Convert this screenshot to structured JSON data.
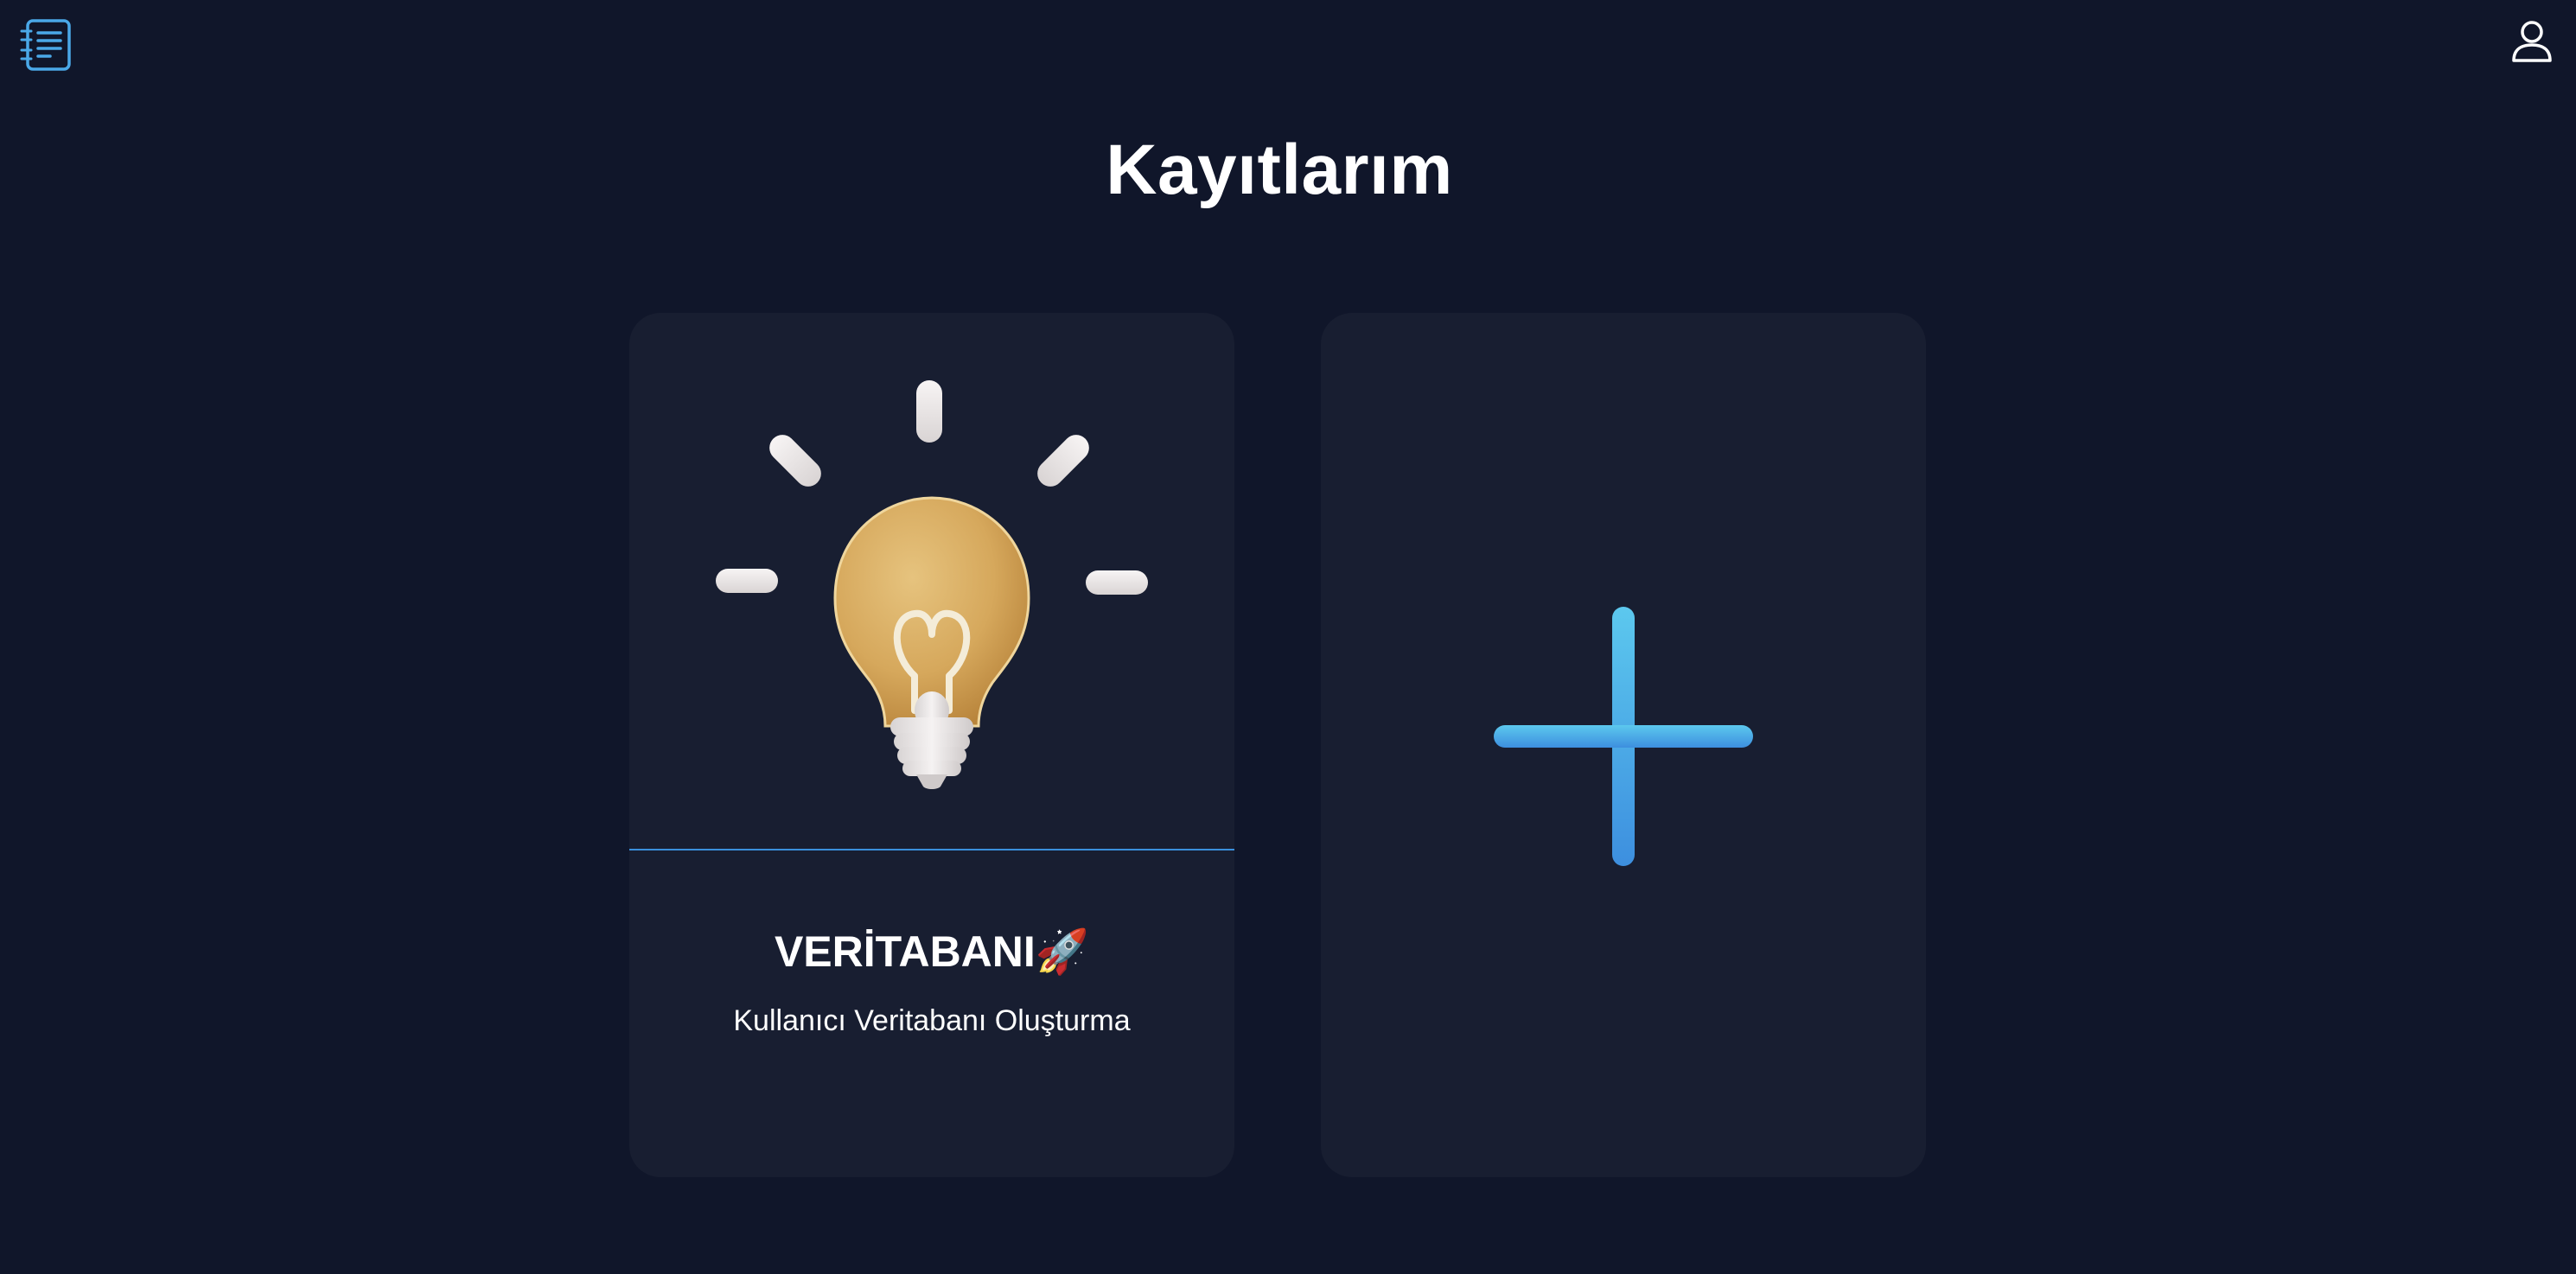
{
  "header": {
    "left_icon": "notebook-list-icon",
    "right_icon": "user-profile-icon"
  },
  "main": {
    "title": "Kayıtlarım",
    "cards": [
      {
        "icon": "lightbulb-icon",
        "title": "VERİTABANI🚀",
        "subtitle": "Kullanıcı Veritabanı Oluşturma"
      },
      {
        "icon": "plus-icon"
      }
    ]
  },
  "colors": {
    "background": "#10162a",
    "card": "#181e31",
    "accent": "#3a8fdc",
    "plus_top": "#5cc8ee",
    "plus_bottom": "#3d8fdf"
  }
}
